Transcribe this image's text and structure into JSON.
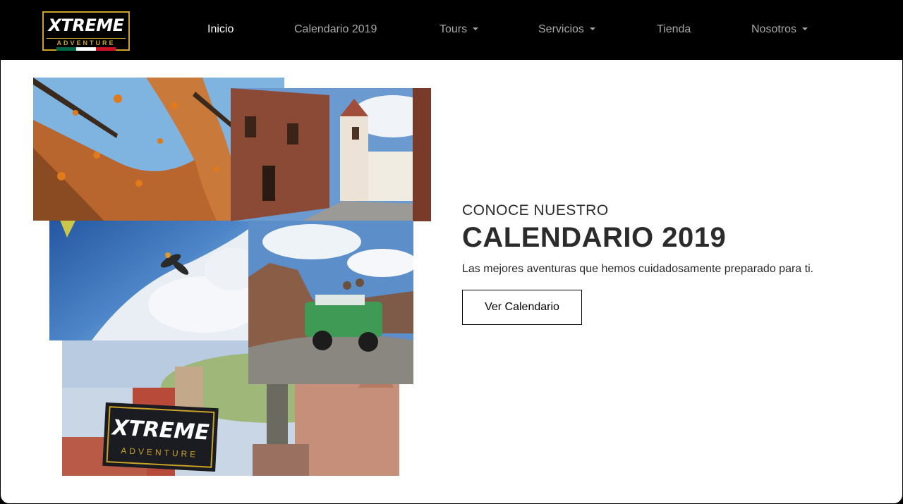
{
  "brand": {
    "logo_text": "XTREME",
    "logo_subtext": "ADVENTURE",
    "logo_country": "México",
    "flag_colors": [
      "#006847",
      "#ffffff",
      "#ce1126"
    ]
  },
  "nav": {
    "items": [
      {
        "label": "Inicio",
        "active": true,
        "dropdown": false
      },
      {
        "label": "Calendario 2019",
        "active": false,
        "dropdown": false
      },
      {
        "label": "Tours",
        "active": false,
        "dropdown": true
      },
      {
        "label": "Servicios",
        "active": false,
        "dropdown": true
      },
      {
        "label": "Tienda",
        "active": false,
        "dropdown": false
      },
      {
        "label": "Nosotros",
        "active": false,
        "dropdown": true
      }
    ]
  },
  "hero": {
    "eyebrow": "CONOCE NUESTRO",
    "headline": "CALENDARIO 2019",
    "subtitle": "Las mejores aventuras que hemos cuidadosamente preparado para ti.",
    "cta_label": "Ver Calendario",
    "banner_text": "XTREME",
    "banner_subtext": "ADVENTURE"
  },
  "colors": {
    "nav_background": "#000000",
    "nav_link": "#a8a8a8",
    "nav_link_active": "#ffffff",
    "logo_accent": "#c9a227",
    "text_dark": "#2b2b2b"
  }
}
